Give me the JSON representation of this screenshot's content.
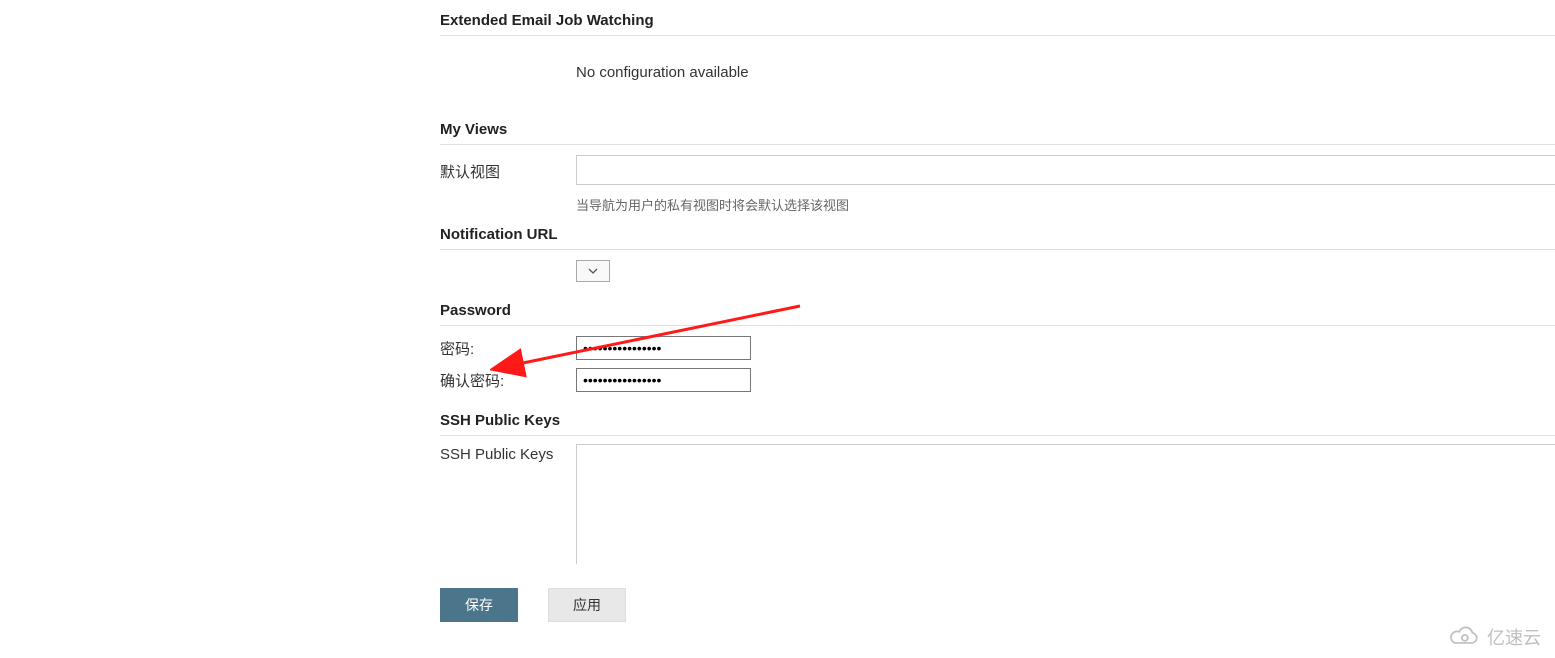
{
  "sections": {
    "email_watching": {
      "title": "Extended Email Job Watching",
      "empty": "No configuration available"
    },
    "my_views": {
      "title": "My Views",
      "default_view_label": "默认视图",
      "default_view_value": "",
      "helper": "当导航为用户的私有视图时将会默认选择该视图"
    },
    "notification_url": {
      "title": "Notification URL"
    },
    "password": {
      "title": "Password",
      "pw_label": "密码:",
      "confirm_label": "确认密码:",
      "pw_value": "••••••••••••••••",
      "confirm_value": "••••••••••••••••"
    },
    "ssh": {
      "title": "SSH Public Keys",
      "label": "SSH Public Keys",
      "value": ""
    }
  },
  "buttons": {
    "save": "保存",
    "apply": "应用"
  },
  "watermark": "亿速云"
}
